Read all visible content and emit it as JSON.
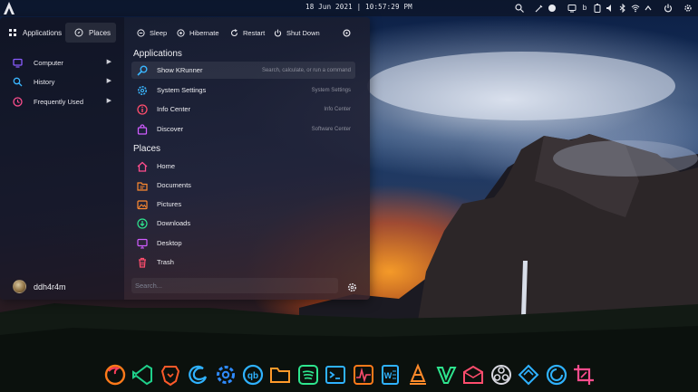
{
  "colors": {
    "accent": "#3aa0ff",
    "icon_red": "#ff4d6d",
    "icon_blue": "#3ab6ff",
    "icon_green": "#2ee58e",
    "icon_purple": "#b266ff",
    "icon_orange": "#ff8a30"
  },
  "top_panel": {
    "clock": "18 Jun 2021 | 10:57:29 PM",
    "launcher_icon": "arch-launcher-icon",
    "tray_icons": [
      "search-icon",
      "color-picker-icon",
      "toggle-icon",
      "clipboard-icon",
      "b-icon",
      "battery-icon",
      "volume-icon",
      "bluetooth-icon",
      "wifi-icon",
      "arrow-up-icon",
      "power-icon",
      "settings-icon"
    ]
  },
  "menu": {
    "tabs": [
      {
        "label": "Applications",
        "icon": "grid-icon"
      },
      {
        "label": "Places",
        "icon": "compass-icon"
      }
    ],
    "sidebar": [
      {
        "label": "Computer",
        "icon": "monitor-icon"
      },
      {
        "label": "History",
        "icon": "search-icon"
      },
      {
        "label": "Frequently Used",
        "icon": "clock-icon"
      }
    ],
    "user": {
      "name": "ddh4r4m"
    },
    "power": [
      {
        "label": "Sleep",
        "icon": "sleep-icon"
      },
      {
        "label": "Hibernate",
        "icon": "hibernate-icon"
      },
      {
        "label": "Restart",
        "icon": "restart-icon"
      },
      {
        "label": "Shut Down",
        "icon": "shutdown-icon"
      }
    ],
    "applications": {
      "title": "Applications",
      "items": [
        {
          "label": "Show KRunner",
          "desc": "Search, calculate, or run a command",
          "icon": "krunner-icon"
        },
        {
          "label": "System Settings",
          "desc": "System Settings",
          "icon": "settings-icon"
        },
        {
          "label": "Info Center",
          "desc": "Info Center",
          "icon": "info-icon"
        },
        {
          "label": "Discover",
          "desc": "Software Center",
          "icon": "discover-icon"
        }
      ]
    },
    "places": {
      "title": "Places",
      "items": [
        {
          "label": "Home",
          "icon": "home-icon"
        },
        {
          "label": "Documents",
          "icon": "documents-icon"
        },
        {
          "label": "Pictures",
          "icon": "pictures-icon"
        },
        {
          "label": "Downloads",
          "icon": "downloads-icon"
        },
        {
          "label": "Desktop",
          "icon": "desktop-icon"
        },
        {
          "label": "Trash",
          "icon": "trash-icon"
        }
      ]
    },
    "search": {
      "placeholder": "Search..."
    }
  },
  "dock": {
    "apps": [
      "firefox-icon",
      "vscode-icon",
      "brave-icon",
      "edge-icon",
      "settings-icon",
      "qbittorrent-icon",
      "files-icon",
      "spotify-icon",
      "terminal-icon",
      "system-monitor-icon",
      "word-icon",
      "vlc-icon",
      "vim-icon",
      "mail-icon",
      "obs-icon",
      "deepin-icon",
      "web-browser-icon",
      "crop-icon"
    ]
  }
}
